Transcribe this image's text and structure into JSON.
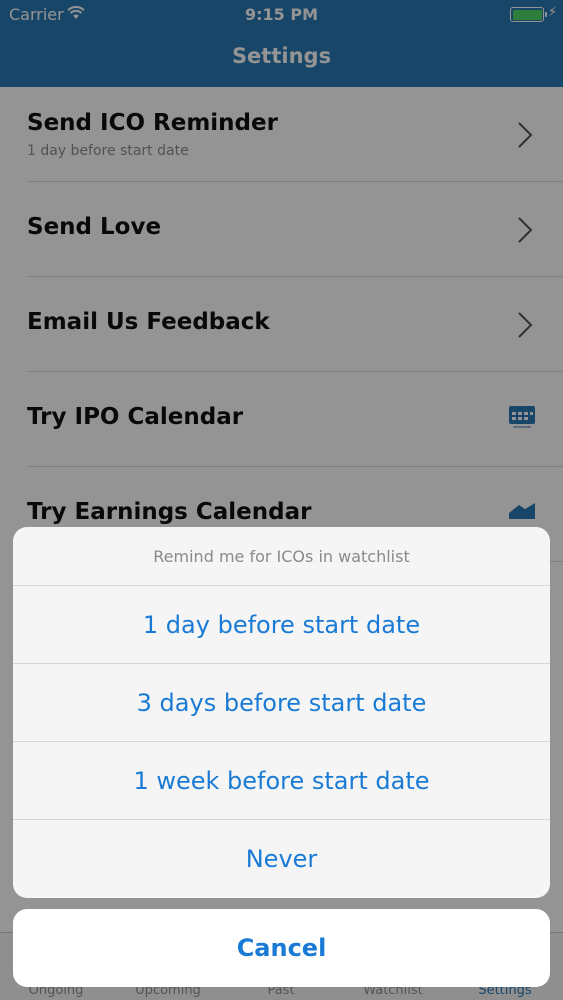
{
  "status_bar": {
    "carrier": "Carrier",
    "time": "9:15 PM"
  },
  "nav": {
    "title": "Settings"
  },
  "settings": {
    "rows": [
      {
        "title": "Send ICO Reminder",
        "subtitle": "1 day before start date",
        "accessory": "chevron-icon"
      },
      {
        "title": "Send Love",
        "accessory": "chevron-icon"
      },
      {
        "title": "Email Us Feedback",
        "accessory": "chevron-icon"
      },
      {
        "title": "Try IPO Calendar",
        "accessory": "ipo-calendar-app-icon"
      },
      {
        "title": "Try Earnings Calendar",
        "accessory": "earnings-calendar-app-icon"
      }
    ]
  },
  "tabs": [
    {
      "label": "Ongoing"
    },
    {
      "label": "Upcoming"
    },
    {
      "label": "Past"
    },
    {
      "label": "Watchlist"
    },
    {
      "label": "Settings"
    }
  ],
  "action_sheet": {
    "title": "Remind me for ICOs in watchlist",
    "options": [
      {
        "label": "1 day before start date"
      },
      {
        "label": "3 days before start date"
      },
      {
        "label": "1 week before start date"
      },
      {
        "label": "Never"
      }
    ],
    "cancel_label": "Cancel"
  },
  "colors": {
    "nav_bar": "#2a79b6",
    "action_text": "#1a7bd6",
    "battery": "#4cd964"
  }
}
